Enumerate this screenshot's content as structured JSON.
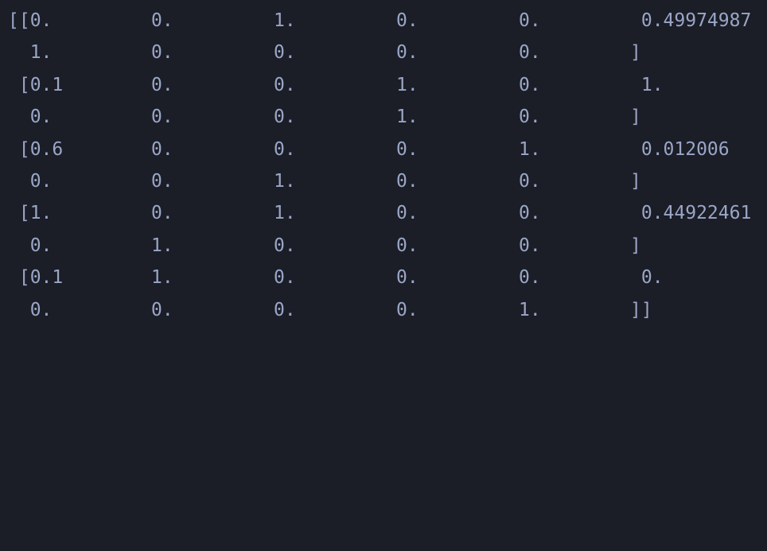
{
  "terminal": {
    "lines": [
      [
        "[[0.",
        "0.",
        "1.",
        "0.",
        "0.",
        " 0.49974987"
      ],
      [
        "  1.",
        "0.",
        "0.",
        "0.",
        "0.",
        "]"
      ],
      [
        " [0.1",
        "0.",
        "0.",
        "1.",
        "0.",
        " 1."
      ],
      [
        "  0.",
        "0.",
        "0.",
        "1.",
        "0.",
        "]"
      ],
      [
        " [0.6",
        "0.",
        "0.",
        "0.",
        "1.",
        " 0.012006"
      ],
      [
        "  0.",
        "0.",
        "1.",
        "0.",
        "0.",
        "]"
      ],
      [
        " [1.",
        "0.",
        "1.",
        "0.",
        "0.",
        " 0.44922461"
      ],
      [
        "  0.",
        "1.",
        "0.",
        "0.",
        "0.",
        "]"
      ],
      [
        " [0.1",
        "1.",
        "0.",
        "0.",
        "0.",
        " 0."
      ],
      [
        "  0.",
        "0.",
        "0.",
        "0.",
        "1.",
        "]]"
      ]
    ]
  }
}
